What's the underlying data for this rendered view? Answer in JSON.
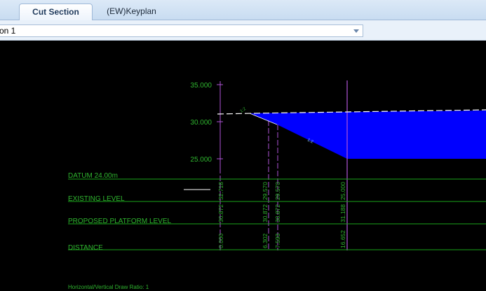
{
  "tabs": [
    {
      "label": "Cut Section",
      "active": true
    },
    {
      "label": "(EW)Keyplan",
      "active": false
    }
  ],
  "section_select": {
    "value": "on 1"
  },
  "drawing": {
    "elevation_labels": [
      "35.000",
      "30.000",
      "25.000"
    ],
    "row_labels": {
      "datum": "DATUM 24.00m",
      "existing": "EXISTING LEVEL",
      "proposed": "PROPOSED PLATFORM LEVEL",
      "distance": "DISTANCE"
    },
    "station_values": [
      {
        "existing": "32.718",
        "proposed": "30.872",
        "distance": "0.000"
      },
      {
        "existing": "29.570",
        "proposed": "30.872",
        "distance": "6.302"
      },
      {
        "existing": "29.570",
        "proposed": "30.872",
        "distance": "7.593"
      },
      {
        "existing": "25.000",
        "proposed": "31.188",
        "distance": "16.652"
      }
    ],
    "slope_labels": [
      "1:2",
      "1:2"
    ],
    "ratio_label": "Horizontal/Vertical Draw Ratio: 1",
    "colors": {
      "background": "#000000",
      "cut_fill": "#0000ff",
      "grid_lines": "#1aa31a",
      "text": "#2fb52f",
      "station_lines": "#b055d8",
      "platform_line": "#ffffff"
    }
  }
}
